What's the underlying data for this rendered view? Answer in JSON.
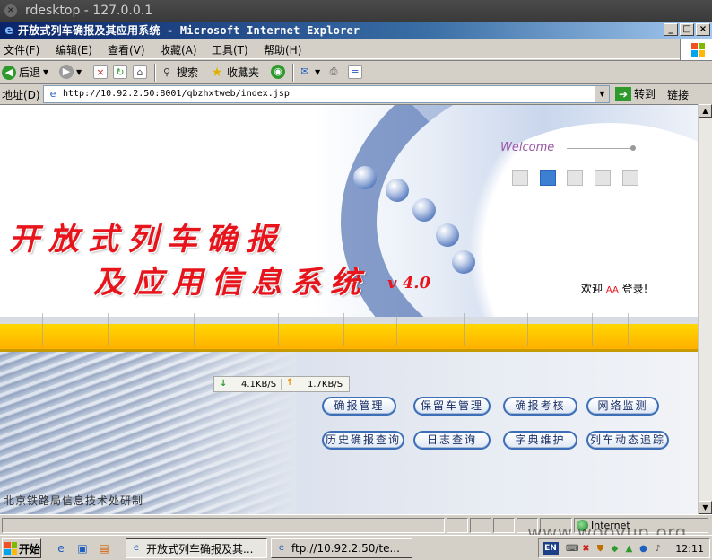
{
  "rdesktop": {
    "title": "rdesktop - 127.0.0.1",
    "close_glyph": "×"
  },
  "window": {
    "title": "开放式列车确报及其应用系统 - Microsoft Internet Explorer",
    "min": "_",
    "max": "□",
    "close": "×"
  },
  "menu": [
    "文件(F)",
    "编辑(E)",
    "查看(V)",
    "收藏(A)",
    "工具(T)",
    "帮助(H)"
  ],
  "toolbar": {
    "back": "后退",
    "search": "搜索",
    "favorites": "收藏夹"
  },
  "address": {
    "label": "地址(D)",
    "url": "http://10.92.2.50:8001/qbzhxtweb/index.jsp",
    "go": "转到",
    "links": "链接"
  },
  "page": {
    "welcome": "Welcome",
    "title_line1": "开放式列车确报",
    "title_line2": "及应用信息系统",
    "version": "v 4.0",
    "greeting_prefix": "欢迎",
    "greeting_user": "AA",
    "greeting_suffix": "登录!",
    "speed_down": "4.1KB/S",
    "speed_up": "1.7KB/S",
    "nav_row1": [
      "确报管理",
      "保留车管理",
      "确报考核",
      "网络监测"
    ],
    "nav_row2": [
      "历史确报查询",
      "日志查询",
      "字典维护",
      "列车动态追踪"
    ],
    "footer": "北京铁路局信息技术处研制"
  },
  "status": {
    "zone": "Internet"
  },
  "taskbar": {
    "start": "开始",
    "tasks": [
      "开放式列车确报及其...",
      "ftp://10.92.2.50/te..."
    ],
    "lang": "EN",
    "clock": "12:11"
  },
  "watermark": "www.wooyun.org",
  "colors": {
    "accent_red": "#e8141c",
    "band_yellow": "#ffd700",
    "ie_blue": "#0a246a"
  }
}
